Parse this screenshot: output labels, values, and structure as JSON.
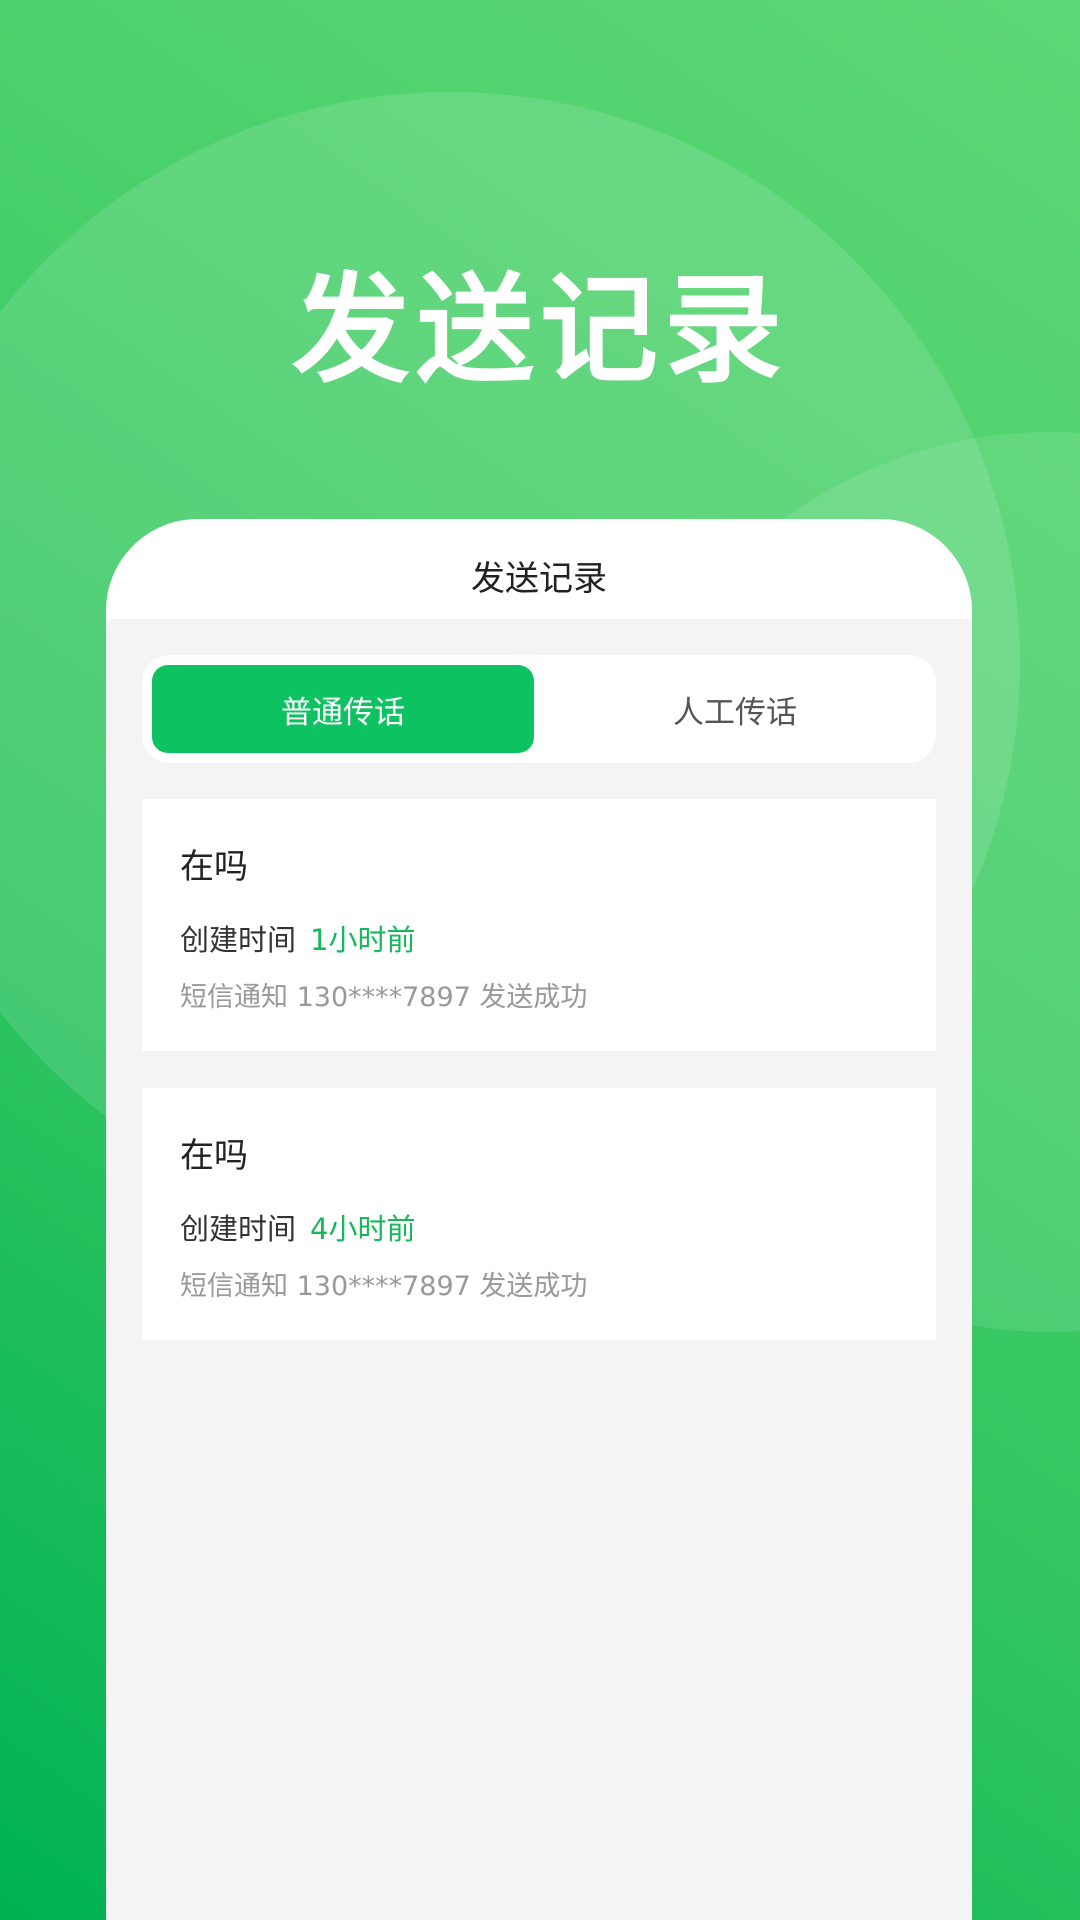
{
  "hero": {
    "title": "发送记录"
  },
  "nav": {
    "title": "发送记录"
  },
  "tabs": [
    {
      "label": "普通传话",
      "active": true
    },
    {
      "label": "人工传话",
      "active": false
    }
  ],
  "records": [
    {
      "message": "在吗",
      "time_label": "创建时间",
      "time_ago": "1小时前",
      "note": "短信通知 130****7897 发送成功"
    },
    {
      "message": "在吗",
      "time_label": "创建时间",
      "time_ago": "4小时前",
      "note": "短信通知 130****7897 发送成功"
    }
  ],
  "colors": {
    "accent": "#0dc260",
    "accent_text": "#17b85b",
    "background_green": "#2cc35f"
  }
}
